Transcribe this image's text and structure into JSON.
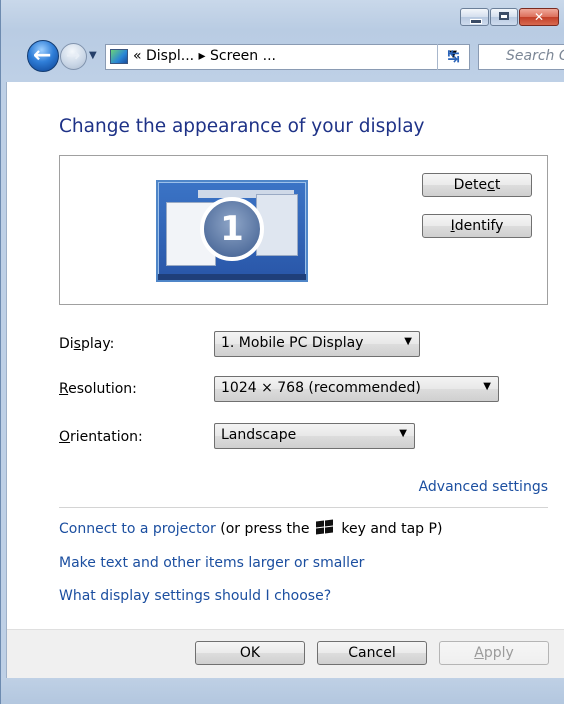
{
  "window": {
    "min_glyph": "",
    "max_glyph": "",
    "close_glyph": "✕"
  },
  "address": {
    "crumb": "« Displ... ▸ Screen ...",
    "search_placeholder": "Search C"
  },
  "main": {
    "title": "Change the appearance of your display",
    "monitor_number": "1",
    "detect_pre": "Dete",
    "detect_acc": "c",
    "detect_post": "t",
    "identify_acc": "I",
    "identify_post": "dentify"
  },
  "settings": {
    "display_label_pre": "Di",
    "display_label_acc": "s",
    "display_label_post": "play:",
    "display_value": "1. Mobile PC Display",
    "resolution_label_acc": "R",
    "resolution_label_post": "esolution:",
    "resolution_value": "1024 × 768 (recommended)",
    "orientation_label_acc": "O",
    "orientation_label_post": "rientation:",
    "orientation_value": "Landscape"
  },
  "links": {
    "advanced": "Advanced settings",
    "projector": "Connect to a projector",
    "projector_hint_pre": " (or press the ",
    "projector_hint_post": " key and tap P)",
    "text_size": "Make text and other items larger or smaller",
    "which_settings": "What display settings should I choose?"
  },
  "footer": {
    "ok": "OK",
    "cancel": "Cancel",
    "apply_acc": "A",
    "apply_post": "pply"
  },
  "colors": {
    "title_blue": "#1e3287",
    "link_blue": "#1c4fa0",
    "frame": "#bed0e6"
  }
}
